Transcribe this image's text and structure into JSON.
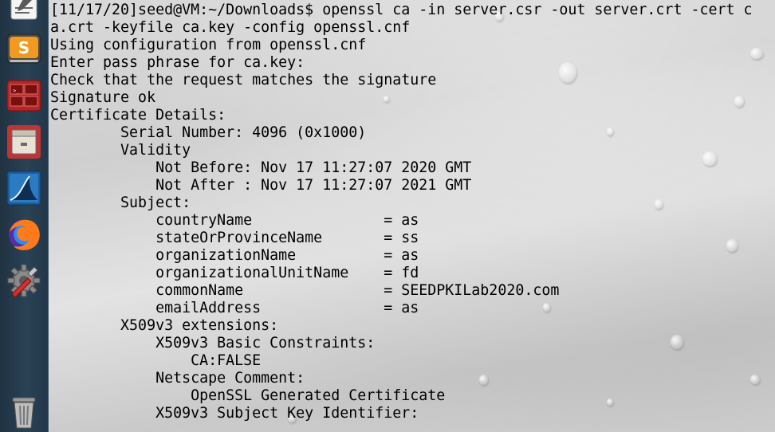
{
  "launcher": {
    "items": [
      {
        "name": "text-editor-icon"
      },
      {
        "name": "sublime-text-icon"
      },
      {
        "name": "terminal-icon"
      },
      {
        "name": "file-manager-icon"
      },
      {
        "name": "wireshark-icon"
      },
      {
        "name": "firefox-icon"
      },
      {
        "name": "settings-icon"
      },
      {
        "name": "trash-icon"
      }
    ],
    "colors": {
      "dock_background": "#2a4255",
      "terminal_icon": "#b52525",
      "sublime_orange": "#f29a1f",
      "firefox_orange": "#ff7a1a"
    }
  },
  "terminal": {
    "lines": [
      "[11/17/20]seed@VM:~/Downloads$ openssl ca -in server.csr -out server.crt -cert c",
      "a.crt -keyfile ca.key -config openssl.cnf",
      "Using configuration from openssl.cnf",
      "Enter pass phrase for ca.key:",
      "Check that the request matches the signature",
      "Signature ok",
      "Certificate Details:",
      "        Serial Number: 4096 (0x1000)",
      "        Validity",
      "            Not Before: Nov 17 11:27:07 2020 GMT",
      "            Not After : Nov 17 11:27:07 2021 GMT",
      "        Subject:",
      "            countryName               = as",
      "            stateOrProvinceName       = ss",
      "            organizationName          = as",
      "            organizationalUnitName    = fd",
      "            commonName                = SEEDPKILab2020.com",
      "            emailAddress              = as",
      "        X509v3 extensions:",
      "            X509v3 Basic Constraints:",
      "                CA:FALSE",
      "            Netscape Comment:",
      "                OpenSSL Generated Certificate",
      "            X509v3 Subject Key Identifier:"
    ],
    "colors": {
      "text": "#000000",
      "background": "#d6d6d6"
    }
  }
}
